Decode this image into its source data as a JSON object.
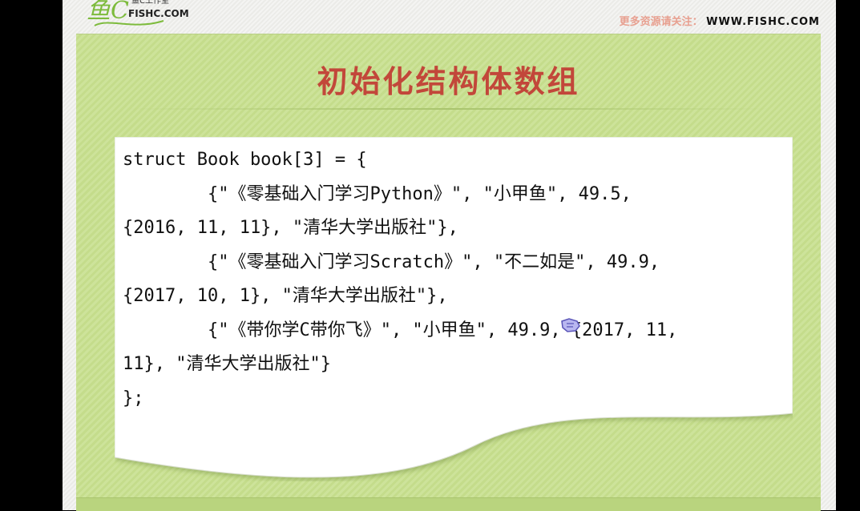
{
  "header": {
    "logo_script": "鱼C",
    "logo_subtitle": "鱼C工作室",
    "logo_text": "FISHC.COM",
    "follow_label": "更多资源请关注：",
    "website": "WWW.FISHC.COM"
  },
  "slide": {
    "title": "初始化结构体数组",
    "code_lines": [
      "struct Book book[3] = {",
      "        {\"《零基础入门学习Python》\", \"小甲鱼\", 49.5,",
      "{2016, 11, 11}, \"清华大学出版社\"},",
      "        {\"《零基础入门学习Scratch》\", \"不二如是\", 49.9,",
      "{2017, 10, 1}, \"清华大学出版社\"},",
      "        {\"《带你学C带你飞》\", \"小甲鱼\", 49.9, {2017, 11,",
      "11}, \"清华大学出版社\"}",
      "};"
    ]
  },
  "colors": {
    "panel_green": "#c8df91",
    "title_red": "#c2473a",
    "card_white": "#ffffff"
  },
  "icons": {
    "cursor": "pointing-hand-cursor-icon"
  }
}
